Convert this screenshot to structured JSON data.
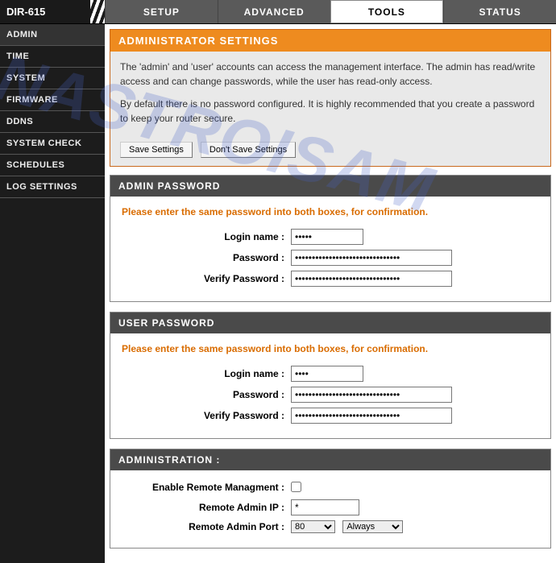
{
  "model": "DIR-615",
  "watermark": "NASTROISAM",
  "tabs": {
    "setup": "SETUP",
    "advanced": "ADVANCED",
    "tools": "TOOLS",
    "status": "STATUS"
  },
  "sidebar": {
    "items": [
      {
        "label": "ADMIN"
      },
      {
        "label": "TIME"
      },
      {
        "label": "SYSTEM"
      },
      {
        "label": "FIRMWARE"
      },
      {
        "label": "DDNS"
      },
      {
        "label": "SYSTEM CHECK"
      },
      {
        "label": "SCHEDULES"
      },
      {
        "label": "LOG SETTINGS"
      }
    ]
  },
  "intro": {
    "title": "ADMINISTRATOR SETTINGS",
    "p1": "The 'admin' and 'user' accounts can access the management interface. The admin has read/write access and can change passwords, while the user has read-only access.",
    "p2": "By default there is no password configured. It is highly recommended that you create a password to keep your router secure.",
    "save": "Save Settings",
    "dont": "Don't Save Settings"
  },
  "admin_pw": {
    "title": "ADMIN PASSWORD",
    "instr": "Please enter the same password into both boxes, for confirmation.",
    "login_label": "Login name :",
    "login_value": "•••••",
    "pwd_label": "Password :",
    "pwd_value": "•••••••••••••••••••••••••••••••",
    "verify_label": "Verify Password :",
    "verify_value": "•••••••••••••••••••••••••••••••"
  },
  "user_pw": {
    "title": "USER PASSWORD",
    "instr": "Please enter the same password into both boxes, for confirmation.",
    "login_label": "Login name :",
    "login_value": "••••",
    "pwd_label": "Password :",
    "pwd_value": "•••••••••••••••••••••••••••••••",
    "verify_label": "Verify Password :",
    "verify_value": "•••••••••••••••••••••••••••••••"
  },
  "administration": {
    "title": "ADMINISTRATION :",
    "enable_label": "Enable Remote Managment :",
    "ip_label": "Remote Admin IP :",
    "ip_value": "*",
    "port_label": "Remote Admin Port :",
    "port_value": "80",
    "schedule_value": "Always"
  }
}
